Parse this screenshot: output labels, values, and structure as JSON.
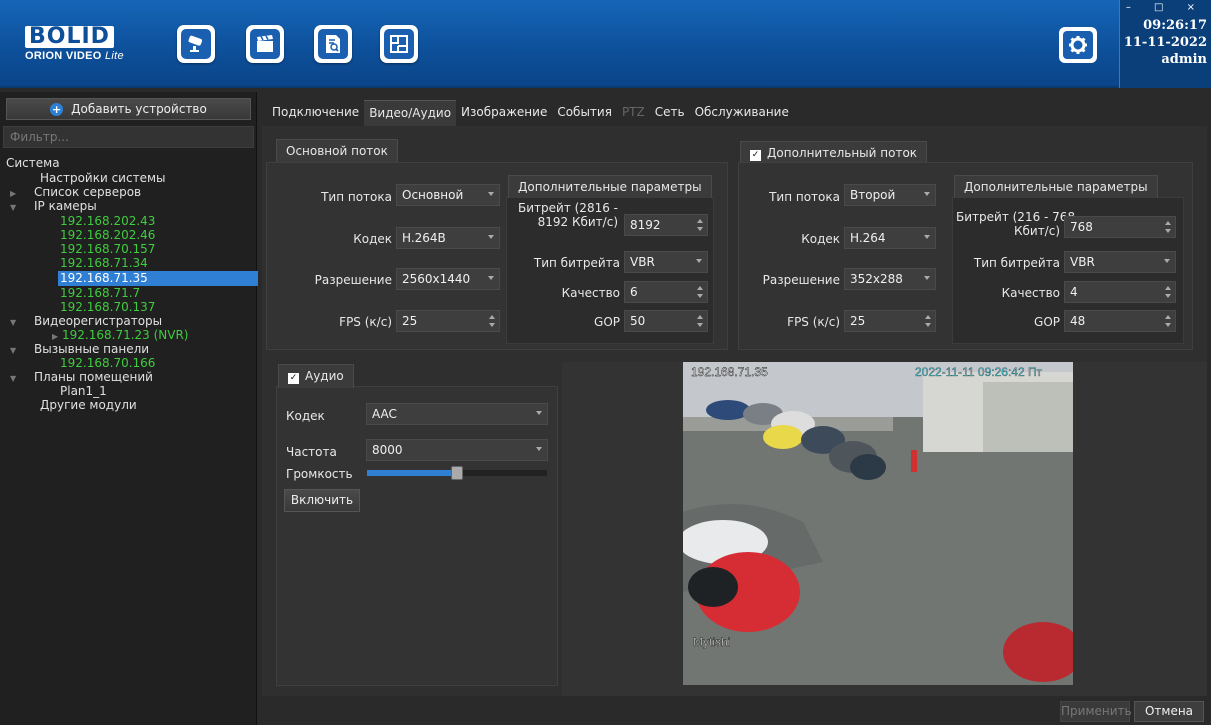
{
  "header": {
    "logo_brand": "BOLID",
    "logo_sub": "ORION VIDEO",
    "logo_sub_italic": "Lite",
    "icons": [
      "camera-icon",
      "clapperboard-icon",
      "document-search-icon",
      "floorplan-icon"
    ],
    "time": "09:26:17",
    "date": "11-11-2022",
    "user": "admin",
    "window_controls": "– □ ×"
  },
  "left": {
    "add_device_label": "Добавить устройство",
    "filter_placeholder": "Фильтр...",
    "tree": {
      "root": "Система",
      "system_settings": "Настройки системы",
      "server_list": "Список серверов",
      "ip_cameras": "IP камеры",
      "cameras": [
        "192.168.202.43",
        "192.168.202.46",
        "192.168.70.157",
        "192.168.71.34",
        "192.168.71.35",
        "192.168.71.7",
        "192.168.70.137"
      ],
      "recorders": "Видеорегистраторы",
      "recorder_item": "192.168.71.23 (NVR)",
      "call_panels": "Вызывные панели",
      "call_panel_item": "192.168.70.166",
      "room_plans": "Планы помещений",
      "plan_item": "Plan1_1",
      "other_modules": "Другие модули"
    }
  },
  "tabs": [
    "Подключение",
    "Видео/Аудио",
    "Изображение",
    "События",
    "PTZ",
    "Сеть",
    "Обслуживание"
  ],
  "main_stream": {
    "title": "Основной поток",
    "type_label": "Тип потока",
    "type_value": "Основной",
    "codec_label": "Кодек",
    "codec_value": "H.264B",
    "resolution_label": "Разрешение",
    "resolution_value": "2560x1440",
    "fps_label": "FPS (к/с)",
    "fps_value": "25",
    "extra_title": "Дополнительные параметры",
    "bitrate_label_1": "Битрейт (2816 -",
    "bitrate_label_2": "8192 Кбит/с)",
    "bitrate_value": "8192",
    "bitrate_type_label": "Тип битрейта",
    "bitrate_type_value": "VBR",
    "quality_label": "Качество",
    "quality_value": "6",
    "gop_label": "GOP",
    "gop_value": "50"
  },
  "sub_stream": {
    "title": "Дополнительный поток",
    "type_label": "Тип потока",
    "type_value": "Второй",
    "codec_label": "Кодек",
    "codec_value": "H.264",
    "resolution_label": "Разрешение",
    "resolution_value": "352x288",
    "fps_label": "FPS (к/с)",
    "fps_value": "25",
    "extra_title": "Дополнительные параметры",
    "bitrate_label_1": "Битрейт (216 - 768",
    "bitrate_label_2": "Кбит/с)",
    "bitrate_value": "768",
    "bitrate_type_label": "Тип битрейта",
    "bitrate_type_value": "VBR",
    "quality_label": "Качество",
    "quality_value": "4",
    "gop_label": "GOP",
    "gop_value": "48"
  },
  "audio": {
    "title": "Аудио",
    "codec_label": "Кодек",
    "codec_value": "AAC",
    "freq_label": "Частота",
    "freq_value": "8000",
    "volume_label": "Громкость",
    "volume_level": 0.5,
    "enable_label": "Включить"
  },
  "video": {
    "osd_ip": "192.168.71.35",
    "osd_time": "2022-11-11 09:26:42 Пт",
    "osd_location": "Mytishi"
  },
  "footer": {
    "apply_label": "Применить",
    "cancel_label": "Отмена"
  },
  "colors": {
    "header_blue": "#0d4f99",
    "selection": "#2f7fd5",
    "tree_green": "#3fcc3f",
    "volume_fill": "#2f7fd5"
  }
}
